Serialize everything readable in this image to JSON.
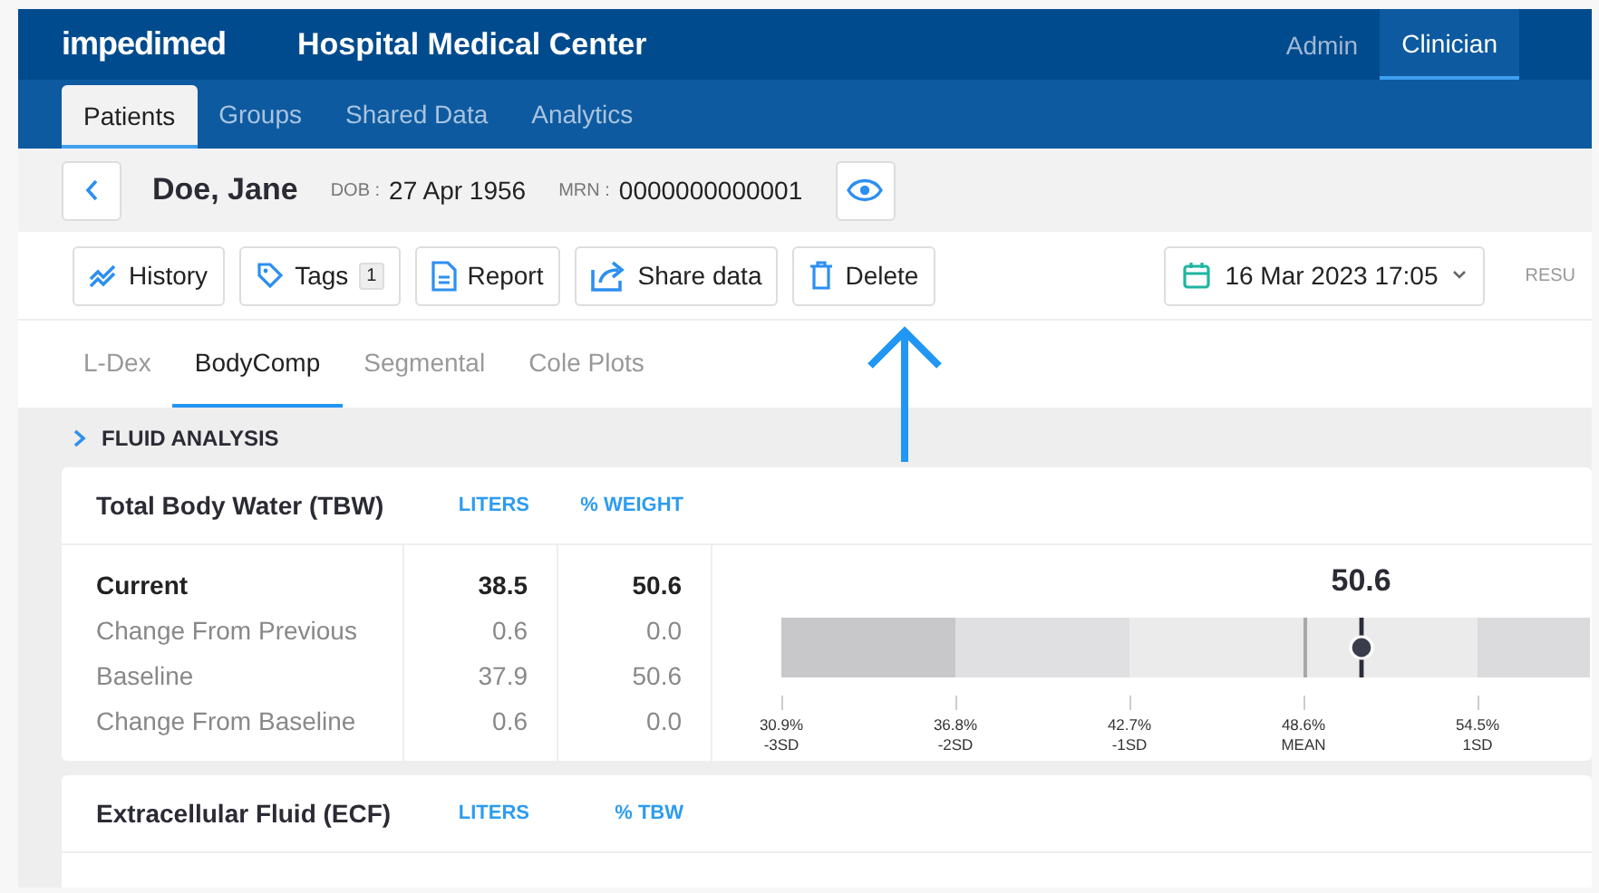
{
  "header": {
    "brand": "impedimed",
    "site": "Hospital Medical Center",
    "roles": [
      {
        "label": "Admin",
        "selected": false
      },
      {
        "label": "Clinician",
        "selected": true
      }
    ]
  },
  "nav": [
    {
      "label": "Patients",
      "selected": true
    },
    {
      "label": "Groups",
      "selected": false
    },
    {
      "label": "Shared Data",
      "selected": false
    },
    {
      "label": "Analytics",
      "selected": false
    }
  ],
  "patient": {
    "name": "Doe, Jane",
    "dob_label": "DOB :",
    "dob": "27 Apr 1956",
    "mrn_label": "MRN :",
    "mrn": "0000000000001"
  },
  "toolbar": {
    "buttons": [
      {
        "kind": "history",
        "label": "History"
      },
      {
        "kind": "tags",
        "label": "Tags",
        "count": "1"
      },
      {
        "kind": "report",
        "label": "Report"
      },
      {
        "kind": "share",
        "label": "Share data"
      },
      {
        "kind": "delete",
        "label": "Delete"
      }
    ],
    "date": "16 Mar 2023 17:05",
    "results_label": "RESU"
  },
  "annotation": {
    "kind": "arrow"
  },
  "tabs": [
    {
      "label": "L-Dex",
      "selected": false
    },
    {
      "label": "BodyComp",
      "selected": true
    },
    {
      "label": "Segmental",
      "selected": false
    },
    {
      "label": "Cole Plots",
      "selected": false
    }
  ],
  "section": {
    "title": "FLUID ANALYSIS",
    "expanded": false
  },
  "cards": [
    {
      "title": "Total Body Water (TBW)",
      "columns": [
        "LITERS",
        "% WEIGHT"
      ],
      "rows": [
        {
          "label": "Current",
          "values": [
            "38.5",
            "50.6"
          ],
          "emphasis": true
        },
        {
          "label": "Change From Previous",
          "values": [
            "0.6",
            "0.0"
          ],
          "emphasis": false
        },
        {
          "label": "Baseline",
          "values": [
            "37.9",
            "50.6"
          ],
          "emphasis": false
        },
        {
          "label": "Change From Baseline",
          "values": [
            "0.6",
            "0.0"
          ],
          "emphasis": false
        }
      ],
      "gauge": {
        "reading": "50.6",
        "level": 0.717,
        "ticks": [
          {
            "value": "30.9%",
            "label": "-3SD"
          },
          {
            "value": "36.8%",
            "label": "-2SD"
          },
          {
            "value": "42.7%",
            "label": "-1SD"
          },
          {
            "value": "48.6%",
            "label": "MEAN"
          },
          {
            "value": "54.5%",
            "label": "1SD"
          }
        ]
      }
    },
    {
      "title": "Extracellular Fluid (ECF)",
      "columns": [
        "LITERS",
        "% TBW"
      ]
    }
  ]
}
